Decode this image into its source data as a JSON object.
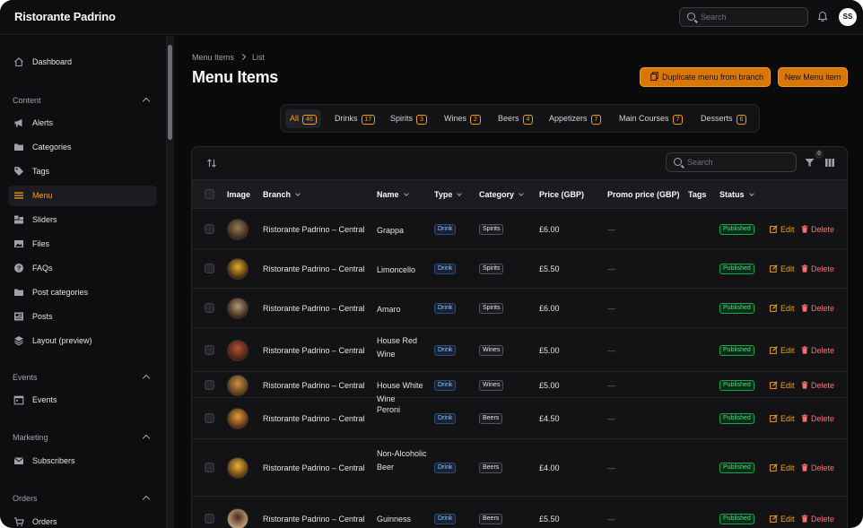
{
  "app": {
    "brand": "Ristorante Padrino",
    "avatar_initials": "SS"
  },
  "topbar": {
    "search_placeholder": "Search"
  },
  "sidebar": {
    "items": [
      {
        "label": "Dashboard",
        "icon": "home-icon"
      },
      {
        "label": "Alerts",
        "icon": "megaphone-icon"
      },
      {
        "label": "Categories",
        "icon": "folder-icon"
      },
      {
        "label": "Tags",
        "icon": "tag-icon"
      },
      {
        "label": "Menu",
        "icon": "bars-icon",
        "active": true
      },
      {
        "label": "Sliders",
        "icon": "slides-icon"
      },
      {
        "label": "Files",
        "icon": "image-icon"
      },
      {
        "label": "FAQs",
        "icon": "question-icon"
      },
      {
        "label": "Post categories",
        "icon": "folder-icon"
      },
      {
        "label": "Posts",
        "icon": "newspaper-icon"
      },
      {
        "label": "Layout (preview)",
        "icon": "layers-icon"
      },
      {
        "label": "Events",
        "icon": "calendar-icon"
      },
      {
        "label": "Subscribers",
        "icon": "envelope-icon"
      },
      {
        "label": "Orders",
        "icon": "cart-icon"
      }
    ],
    "sections": [
      "Content",
      "Events",
      "Marketing",
      "Orders"
    ]
  },
  "breadcrumb": {
    "parent": "Menu Items",
    "current": "List"
  },
  "page": {
    "title": "Menu Items",
    "duplicate_label": "Duplicate menu from branch",
    "new_label": "New Menu item"
  },
  "tabs": [
    {
      "label": "All",
      "count": "46",
      "active": true
    },
    {
      "label": "Drinks",
      "count": "17"
    },
    {
      "label": "Spirits",
      "count": "3"
    },
    {
      "label": "Wines",
      "count": "2"
    },
    {
      "label": "Beers",
      "count": "4"
    },
    {
      "label": "Appetizers",
      "count": "7"
    },
    {
      "label": "Main Courses",
      "count": "7"
    },
    {
      "label": "Desserts",
      "count": "6"
    }
  ],
  "table": {
    "search_placeholder": "Search",
    "filter_count": "0",
    "columns": {
      "image": "Image",
      "branch": "Branch",
      "name": "Name",
      "type": "Type",
      "category": "Category",
      "price": "Price (GBP)",
      "promo": "Promo price (GBP)",
      "tags": "Tags",
      "status": "Status"
    },
    "edit_label": "Edit",
    "delete_label": "Delete",
    "empty_mark": "—",
    "rows": [
      {
        "branch": "Ristorante Padrino – Central",
        "name": "Grappa",
        "type": "Drink",
        "category": "Spirits",
        "price": "£6.00",
        "status": "Published"
      },
      {
        "branch": "Ristorante Padrino – Central",
        "name": "Limoncello",
        "type": "Drink",
        "category": "Spirits",
        "price": "£5.50",
        "status": "Published"
      },
      {
        "branch": "Ristorante Padrino – Central",
        "name": "Amaro",
        "type": "Drink",
        "category": "Spirits",
        "price": "£6.00",
        "status": "Published"
      },
      {
        "branch": "Ristorante Padrino – Central",
        "name": "House Red Wine",
        "type": "Drink",
        "category": "Wines",
        "price": "£5.00",
        "status": "Published"
      },
      {
        "branch": "Ristorante Padrino – Central",
        "name": "House White Wine",
        "type": "Drink",
        "category": "Wines",
        "price": "£5.00",
        "status": "Published"
      },
      {
        "branch": "Ristorante Padrino – Central",
        "name": "Peroni",
        "type": "Drink",
        "category": "Beers",
        "price": "£4.50",
        "status": "Published"
      },
      {
        "branch": "Ristorante Padrino – Central",
        "name": "Non-Alcoholic Beer",
        "type": "Drink",
        "category": "Beers",
        "price": "£4.00",
        "status": "Published"
      },
      {
        "branch": "Ristorante Padrino – Central",
        "name": "Guinness",
        "type": "Drink",
        "category": "Beers",
        "price": "£5.50",
        "status": "Published"
      }
    ]
  }
}
